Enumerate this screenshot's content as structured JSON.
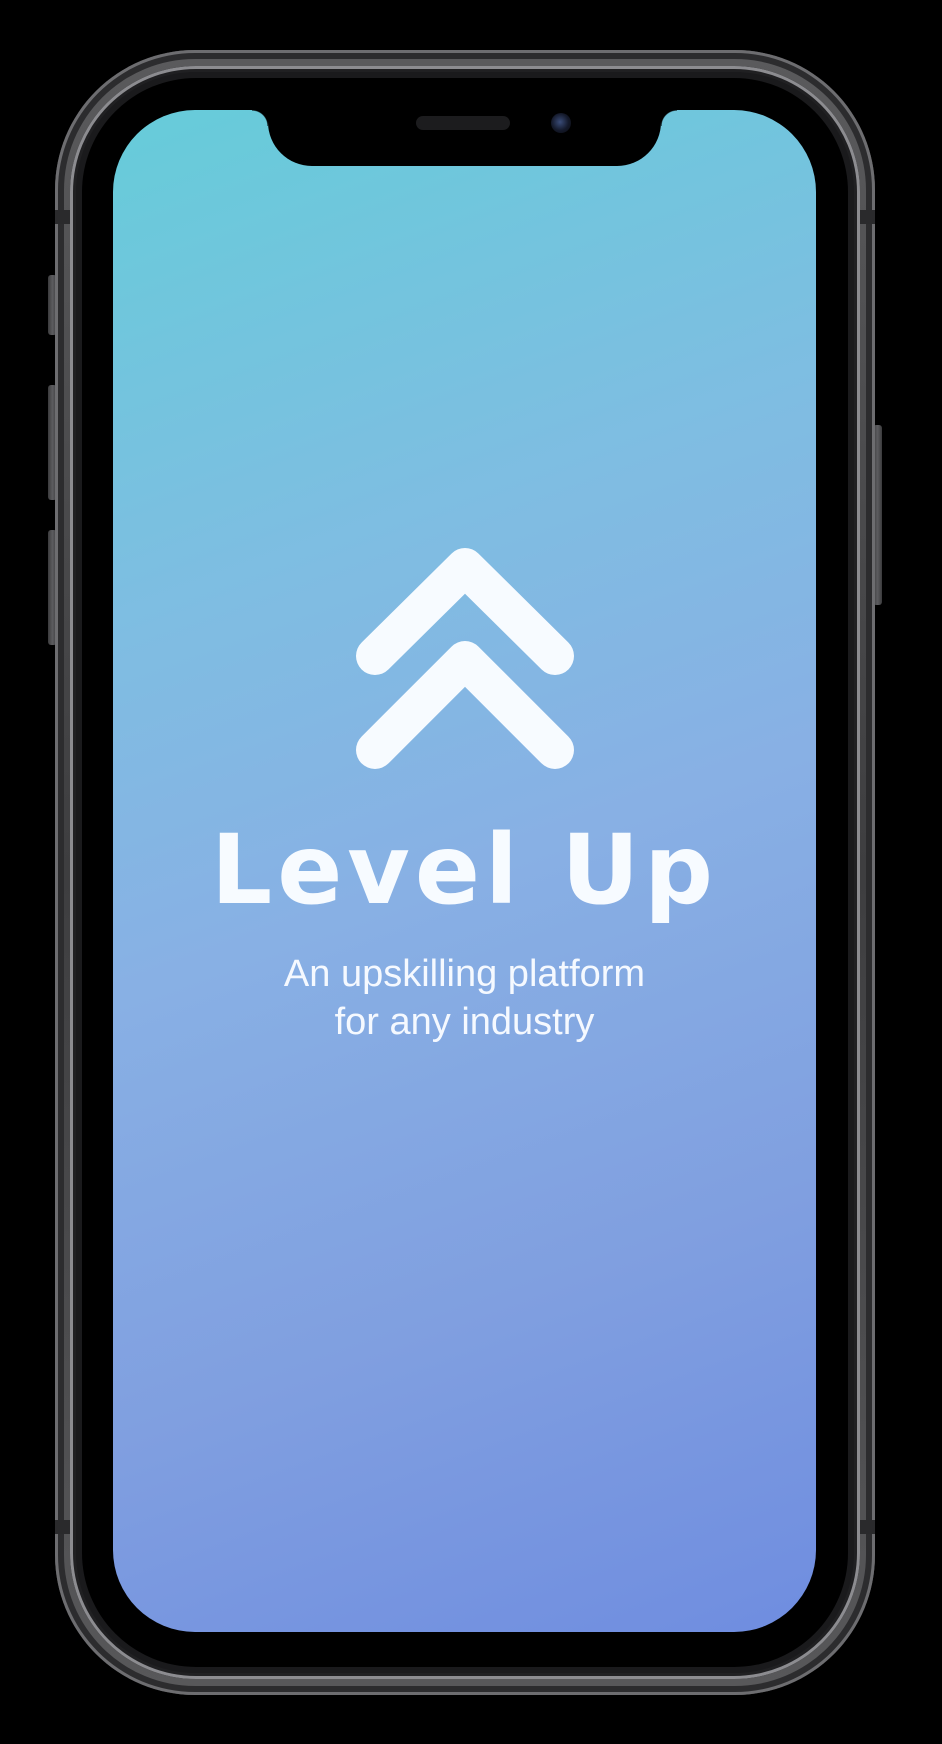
{
  "app": {
    "title": "Level Up",
    "tagline_line1": "An upskilling platform",
    "tagline_line2": "for any industry",
    "logo_icon": "double-chevron-up-icon"
  },
  "colors": {
    "gradient_top": "#66ccd9",
    "gradient_bottom": "#6f8de0",
    "foreground": "#f7fbff",
    "device_frame": "#4a4a4c"
  }
}
